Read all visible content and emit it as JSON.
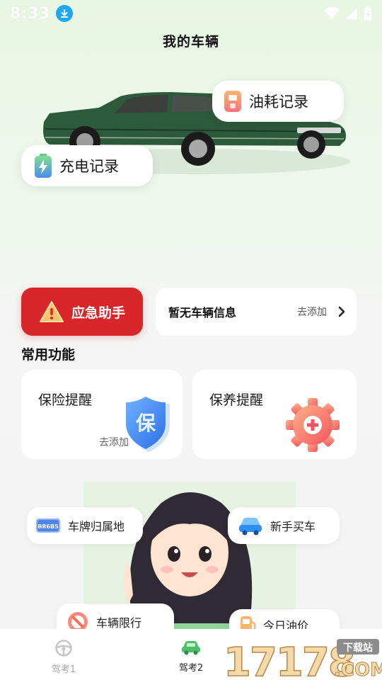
{
  "status_bar": {
    "time": "8:33"
  },
  "header": {
    "title": "我的车辆"
  },
  "float_cards": {
    "fuel_label": "油耗记录",
    "charge_label": "充电记录"
  },
  "emergency": {
    "label": "应急助手"
  },
  "vehicle": {
    "empty_text": "暂无车辆信息",
    "add_label": "去添加"
  },
  "section": {
    "title": "常用功能"
  },
  "functions": {
    "insurance": {
      "title": "保险提醒",
      "add_label": "去添加",
      "icon_text": "保"
    },
    "maintenance": {
      "title": "保养提醒"
    }
  },
  "chips": {
    "plate": {
      "label": "车牌归属地",
      "plate_text": "BR6B5"
    },
    "new_car": {
      "label": "新手买车"
    },
    "restriction": {
      "label": "车辆限行"
    },
    "oil_price": {
      "label": "今日油价"
    }
  },
  "bottom_nav": {
    "items": [
      {
        "label": "驾考1",
        "active": false
      },
      {
        "label": "驾考2",
        "active": true
      },
      {
        "label": "",
        "active": false
      }
    ]
  },
  "watermark": {
    "text": "17178",
    "badge": "下载站",
    "suffix": ".COM"
  },
  "colors": {
    "accent_green": "#4bbf6a",
    "emergency_red": "#d9262b",
    "download_blue": "#1ea7f2"
  }
}
